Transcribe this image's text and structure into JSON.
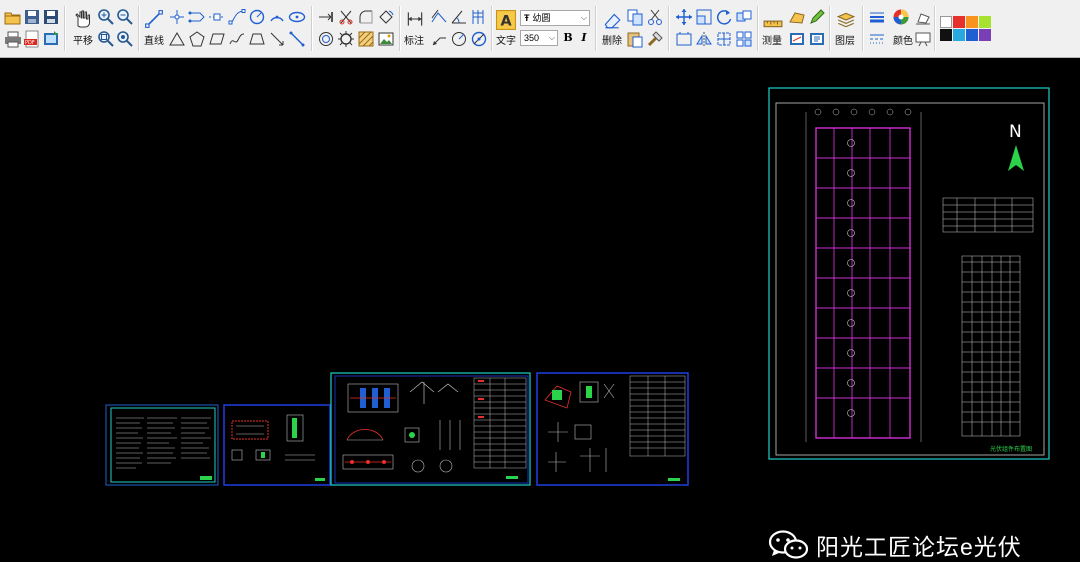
{
  "toolbar": {
    "pan_label": "平移",
    "line_label": "直线",
    "dimension_label": "标注",
    "text_label": "文字",
    "font_name": "幼圆",
    "font_size": "350",
    "bold_label": "B",
    "italic_label": "I",
    "delete_label": "删除",
    "measure_label": "测量",
    "layer_label": "图层",
    "color_label": "颜色",
    "palette": [
      "#ffffff",
      "#e8302a",
      "#f7931e",
      "#a6e22e",
      "#111111",
      "#2aa9e0",
      "#1f5fd1",
      "#7b3fb5"
    ]
  },
  "canvas": {
    "north_label": "N",
    "sheet_title": "光伏组件布置图",
    "watermark": "阳光工匠论坛e光伏"
  }
}
